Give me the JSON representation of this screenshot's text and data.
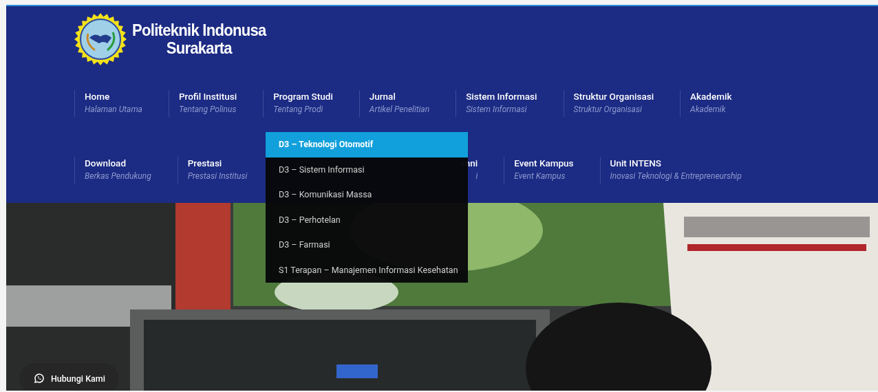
{
  "header": {
    "brand": {
      "line_1": "Politeknik Indonusa",
      "line_2": "Surakarta"
    }
  },
  "nav_rows": [
    {
      "items": [
        {
          "title": "Home",
          "subtitle": "Halaman Utama",
          "kind": "item"
        },
        {
          "title": "Profil Institusi",
          "subtitle": "Tentang Polinus",
          "kind": "item"
        },
        {
          "title": "Program Studi",
          "subtitle": "Tentang Prodi",
          "kind": "item"
        },
        {
          "title": "Jurnal",
          "subtitle": "Artikel Penelitian",
          "kind": "item"
        },
        {
          "title": "Sistem Informasi",
          "subtitle": "Sistem Informasi",
          "kind": "item"
        },
        {
          "title": "Struktur Organisasi",
          "subtitle": "Struktur Organisasi",
          "kind": "item"
        },
        {
          "title": "Akademik",
          "subtitle": "Akademik",
          "kind": "item"
        }
      ]
    },
    {
      "items": [
        {
          "title": "Download",
          "subtitle": "Berkas Pendukung",
          "kind": "item"
        },
        {
          "title": "Prestasi",
          "subtitle": "Prestasi Institusi",
          "kind": "item"
        },
        {
          "title": "mni",
          "subtitle": "i",
          "kind": "covered"
        },
        {
          "title": "Event Kampus",
          "subtitle": "Event Kampus",
          "kind": "item"
        },
        {
          "title": "Unit INTENS",
          "subtitle": "Inovasi Teknologi & Entrepreneurship",
          "kind": "item"
        }
      ]
    }
  ],
  "dropdown": {
    "items": [
      {
        "label": "D3 – Teknologi Otomotif",
        "selected": true
      },
      {
        "label": "D3 – Sistem Informasi",
        "selected": false
      },
      {
        "label": "D3 – Komunikasi Massa",
        "selected": false
      },
      {
        "label": "D3 – Perhotelan",
        "selected": false
      },
      {
        "label": "D3 – Farmasi",
        "selected": false
      },
      {
        "label": "S1 Terapan – Manajemen Informasi Kesehatan",
        "selected": false
      }
    ]
  },
  "contact_button": {
    "label": "Hubungi Kami"
  }
}
